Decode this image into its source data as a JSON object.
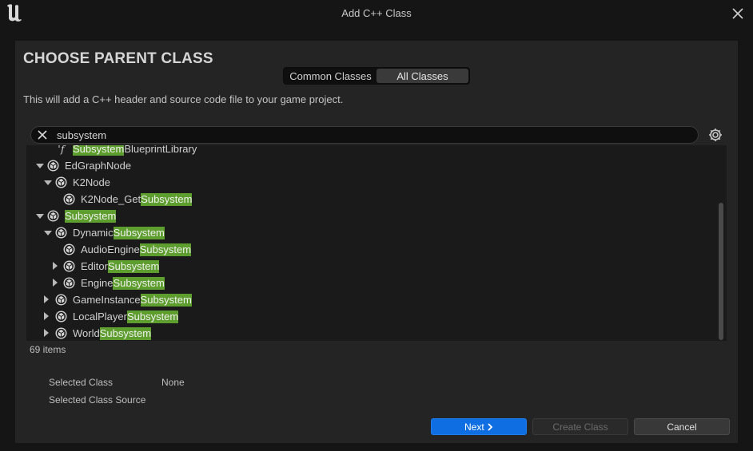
{
  "window": {
    "title": "Add C++ Class"
  },
  "heading": "CHOOSE PARENT CLASS",
  "tabs": [
    {
      "label": "Common Classes",
      "active": false
    },
    {
      "label": "All Classes",
      "active": true
    }
  ],
  "description": "This will add a C++ header and source code file to your game project.",
  "search": {
    "value": "subsystem"
  },
  "tree": {
    "rows": [
      {
        "pre": "",
        "hl": "Subsystem",
        "post": "BlueprintLibrary",
        "icon": "function-icon",
        "arrow": "none"
      },
      {
        "pre": "EdGraphNode",
        "hl": "",
        "post": "",
        "icon": "class-icon",
        "arrow": "down"
      },
      {
        "pre": "K2Node",
        "hl": "",
        "post": "",
        "icon": "class-icon",
        "arrow": "down"
      },
      {
        "pre": "K2Node_Get",
        "hl": "Subsystem",
        "post": "",
        "icon": "class-icon",
        "arrow": "none"
      },
      {
        "pre": "",
        "hl": "Subsystem",
        "post": "",
        "icon": "class-icon",
        "arrow": "down"
      },
      {
        "pre": "Dynamic",
        "hl": "Subsystem",
        "post": "",
        "icon": "class-icon",
        "arrow": "down"
      },
      {
        "pre": "AudioEngine",
        "hl": "Subsystem",
        "post": "",
        "icon": "class-icon",
        "arrow": "none"
      },
      {
        "pre": "Editor",
        "hl": "Subsystem",
        "post": "",
        "icon": "class-icon",
        "arrow": "right"
      },
      {
        "pre": "Engine",
        "hl": "Subsystem",
        "post": "",
        "icon": "class-icon",
        "arrow": "right"
      },
      {
        "pre": "GameInstance",
        "hl": "Subsystem",
        "post": "",
        "icon": "class-icon",
        "arrow": "right"
      },
      {
        "pre": "LocalPlayer",
        "hl": "Subsystem",
        "post": "",
        "icon": "class-icon",
        "arrow": "right"
      },
      {
        "pre": "World",
        "hl": "Subsystem",
        "post": "",
        "icon": "class-icon",
        "arrow": "right"
      }
    ]
  },
  "items_count": "69 items",
  "selected_class": {
    "label": "Selected Class",
    "value": "None"
  },
  "selected_class_source": {
    "label": "Selected Class Source",
    "value": ""
  },
  "buttons": {
    "next": "Next",
    "create": "Create Class",
    "cancel": "Cancel"
  },
  "colors": {
    "accent": "#0f6ee1",
    "highlight": "#5e9e2e",
    "background": "#242424"
  }
}
